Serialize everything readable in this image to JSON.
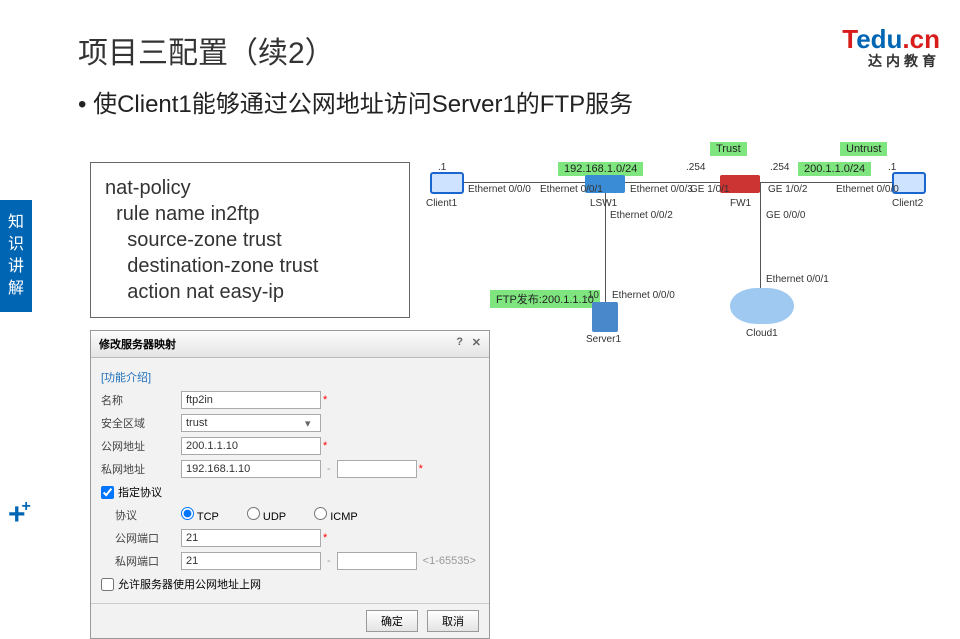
{
  "title": "项目三配置（续2）",
  "logo": {
    "t": "T",
    "edu": "edu",
    "cn": ".cn",
    "sub": "达内教育"
  },
  "bullet": "• 使Client1能够通过公网地址访问Server1的FTP服务",
  "side_tab": "知识讲解",
  "code": "nat-policy\n  rule name in2ftp\n    source-zone trust\n    destination-zone trust\n    action nat easy-ip",
  "diagram": {
    "zone_trust": "Trust",
    "zone_untrust": "Untrust",
    "net1": "192.168.1.0/24",
    "net2": "200.1.1.0/24",
    "ip_c1": ".1",
    "ip_lsw_l": ".254",
    "ip_fw_r": ".254",
    "ip_c2": ".1",
    "ip_srv": ".10",
    "label_c1": "Client1",
    "label_lsw": "LSW1",
    "label_fw": "FW1",
    "label_c2": "Client2",
    "label_srv": "Server1",
    "label_cloud": "Cloud1",
    "if_eth000": "Ethernet 0/0/0",
    "if_eth001": "Ethernet 0/0/1",
    "if_eth002": "Ethernet 0/0/2",
    "if_eth003": "Ethernet 0/0/3",
    "if_ge101": "GE 1/0/1",
    "if_ge102": "GE 1/0/2",
    "if_ge000": "GE 0/0/0",
    "ftp_pub": "FTP发布:200.1.1.10"
  },
  "form": {
    "title": "修改服务器映射",
    "help_link": "[功能介绍]",
    "l_name": "名称",
    "v_name": "ftp2in",
    "l_zone": "安全区域",
    "v_zone": "trust",
    "l_pub_ip": "公网地址",
    "v_pub_ip": "200.1.1.10",
    "l_priv_ip": "私网地址",
    "v_priv_ip": "192.168.1.10",
    "l_proto_chk": "指定协议",
    "l_proto": "协议",
    "opt_tcp": "TCP",
    "opt_udp": "UDP",
    "opt_icmp": "ICMP",
    "l_pub_port": "公网端口",
    "v_pub_port": "21",
    "l_priv_port": "私网端口",
    "v_priv_port": "21",
    "port_hint": "<1-65535>",
    "l_allow": "允许服务器使用公网地址上网",
    "btn_ok": "确定",
    "btn_cancel": "取消",
    "dash": "-"
  }
}
